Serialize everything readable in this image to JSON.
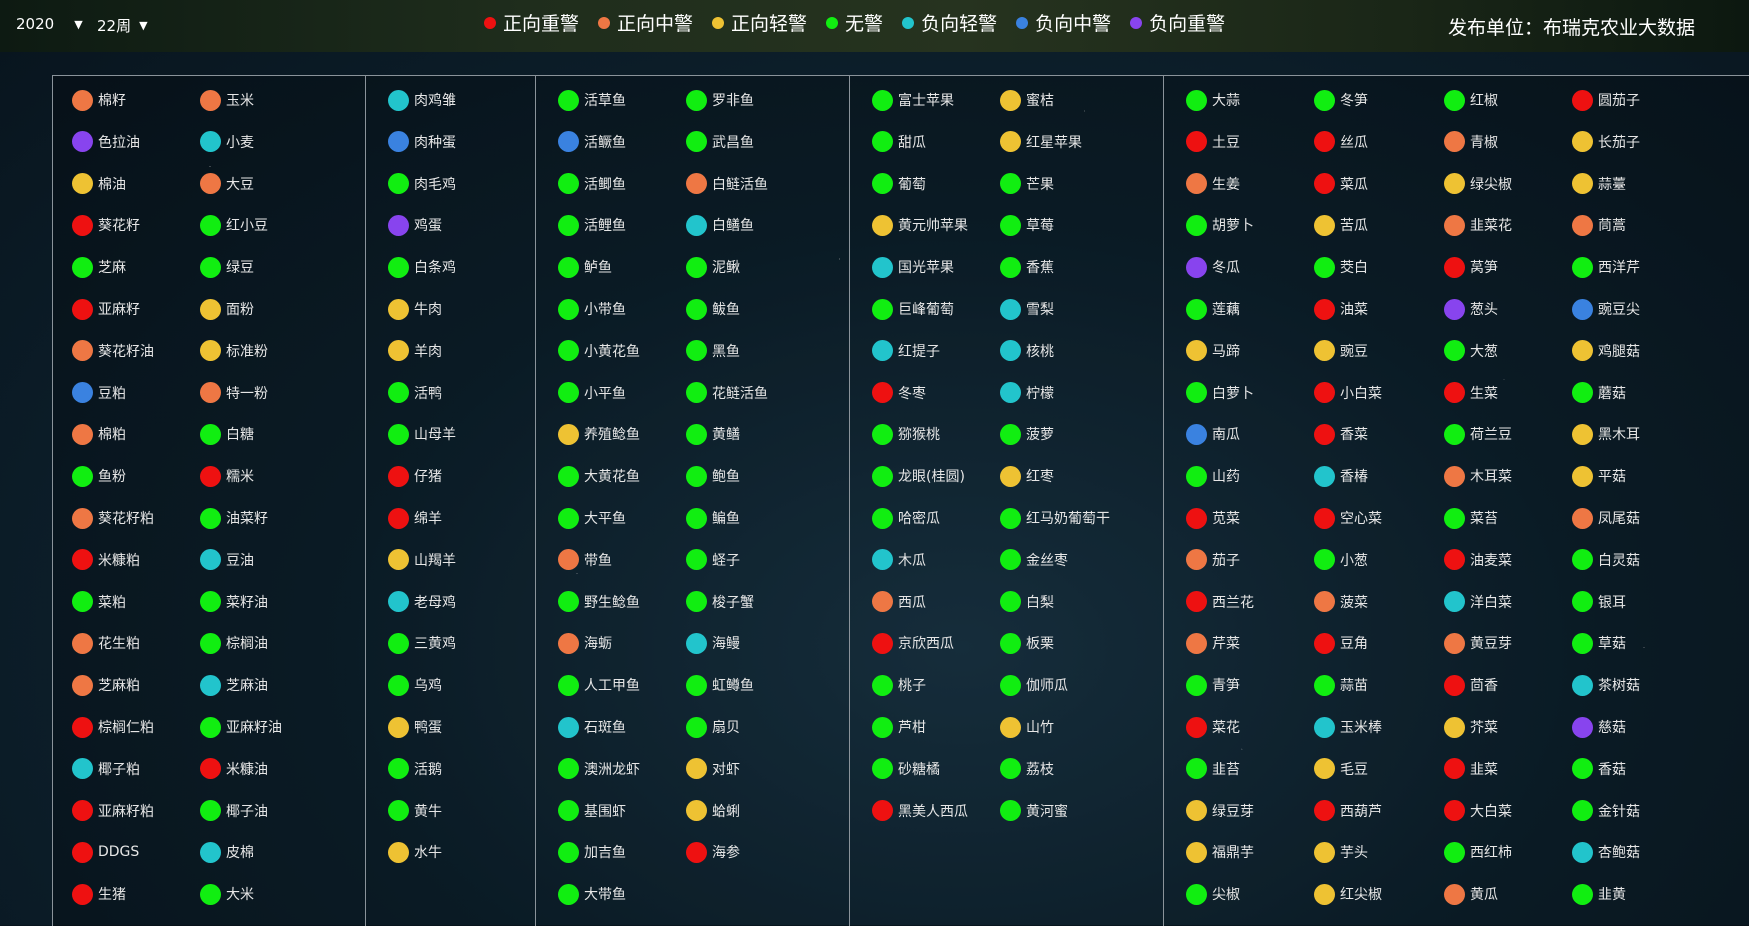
{
  "header": {
    "year": "2020",
    "week": "22周",
    "publisher": "发布单位：布瑞克农业大数据"
  },
  "legend": [
    {
      "key": "pos_severe",
      "label": "正向重警",
      "color": "#ee1111"
    },
    {
      "key": "pos_medium",
      "label": "正向中警",
      "color": "#ee7744"
    },
    {
      "key": "pos_light",
      "label": "正向轻警",
      "color": "#eec233"
    },
    {
      "key": "none",
      "label": "无警",
      "color": "#11ee11"
    },
    {
      "key": "neg_light",
      "label": "负向轻警",
      "color": "#22c4cc"
    },
    {
      "key": "neg_medium",
      "label": "负向中警",
      "color": "#3a82e0"
    },
    {
      "key": "neg_severe",
      "label": "负向重警",
      "color": "#8844ee"
    }
  ],
  "groups": [
    {
      "name": "grains-oils",
      "columns": [
        [
          [
            "棉籽",
            "pos_medium"
          ],
          [
            "色拉油",
            "neg_severe"
          ],
          [
            "棉油",
            "pos_light"
          ],
          [
            "葵花籽",
            "pos_severe"
          ],
          [
            "芝麻",
            "none"
          ],
          [
            "亚麻籽",
            "pos_severe"
          ],
          [
            "葵花籽油",
            "pos_medium"
          ],
          [
            "豆粕",
            "neg_medium"
          ],
          [
            "棉粕",
            "pos_medium"
          ],
          [
            "鱼粉",
            "none"
          ],
          [
            "葵花籽粕",
            "pos_medium"
          ],
          [
            "米糠粕",
            "pos_severe"
          ],
          [
            "菜粕",
            "none"
          ],
          [
            "花生粕",
            "pos_medium"
          ],
          [
            "芝麻粕",
            "pos_medium"
          ],
          [
            "棕榈仁粕",
            "pos_severe"
          ],
          [
            "椰子粕",
            "neg_light"
          ],
          [
            "亚麻籽粕",
            "pos_severe"
          ],
          [
            "DDGS",
            "pos_severe"
          ],
          [
            "生猪",
            "pos_severe"
          ]
        ],
        [
          [
            "玉米",
            "pos_medium"
          ],
          [
            "小麦",
            "neg_light"
          ],
          [
            "大豆",
            "pos_medium"
          ],
          [
            "红小豆",
            "none"
          ],
          [
            "绿豆",
            "none"
          ],
          [
            "面粉",
            "pos_light"
          ],
          [
            "标准粉",
            "pos_light"
          ],
          [
            "特一粉",
            "pos_medium"
          ],
          [
            "白糖",
            "none"
          ],
          [
            "糯米",
            "pos_severe"
          ],
          [
            "油菜籽",
            "none"
          ],
          [
            "豆油",
            "neg_light"
          ],
          [
            "菜籽油",
            "none"
          ],
          [
            "棕榈油",
            "none"
          ],
          [
            "芝麻油",
            "neg_light"
          ],
          [
            "亚麻籽油",
            "none"
          ],
          [
            "米糠油",
            "pos_severe"
          ],
          [
            "椰子油",
            "none"
          ],
          [
            "皮棉",
            "neg_light"
          ],
          [
            "大米",
            "none"
          ]
        ]
      ]
    },
    {
      "name": "livestock",
      "columns": [
        [
          [
            "肉鸡雏",
            "neg_light"
          ],
          [
            "肉种蛋",
            "neg_medium"
          ],
          [
            "肉毛鸡",
            "none"
          ],
          [
            "鸡蛋",
            "neg_severe"
          ],
          [
            "白条鸡",
            "none"
          ],
          [
            "牛肉",
            "pos_light"
          ],
          [
            "羊肉",
            "pos_light"
          ],
          [
            "活鸭",
            "none"
          ],
          [
            "山母羊",
            "none"
          ],
          [
            "仔猪",
            "pos_severe"
          ],
          [
            "绵羊",
            "pos_severe"
          ],
          [
            "山羯羊",
            "pos_light"
          ],
          [
            "老母鸡",
            "neg_light"
          ],
          [
            "三黄鸡",
            "none"
          ],
          [
            "乌鸡",
            "none"
          ],
          [
            "鸭蛋",
            "pos_light"
          ],
          [
            "活鹅",
            "none"
          ],
          [
            "黄牛",
            "none"
          ],
          [
            "水牛",
            "pos_light"
          ]
        ]
      ]
    },
    {
      "name": "aquatic",
      "columns": [
        [
          [
            "活草鱼",
            "none"
          ],
          [
            "活鳜鱼",
            "neg_medium"
          ],
          [
            "活鲫鱼",
            "none"
          ],
          [
            "活鲤鱼",
            "none"
          ],
          [
            "鲈鱼",
            "none"
          ],
          [
            "小带鱼",
            "none"
          ],
          [
            "小黄花鱼",
            "none"
          ],
          [
            "小平鱼",
            "none"
          ],
          [
            "养殖鲶鱼",
            "pos_light"
          ],
          [
            "大黄花鱼",
            "none"
          ],
          [
            "大平鱼",
            "none"
          ],
          [
            "带鱼",
            "pos_medium"
          ],
          [
            "野生鲶鱼",
            "none"
          ],
          [
            "海蛎",
            "pos_medium"
          ],
          [
            "人工甲鱼",
            "none"
          ],
          [
            "石斑鱼",
            "neg_light"
          ],
          [
            "澳洲龙虾",
            "none"
          ],
          [
            "基围虾",
            "none"
          ],
          [
            "加吉鱼",
            "none"
          ],
          [
            "大带鱼",
            "none"
          ]
        ],
        [
          [
            "罗非鱼",
            "none"
          ],
          [
            "武昌鱼",
            "none"
          ],
          [
            "白鲢活鱼",
            "pos_medium"
          ],
          [
            "白鳝鱼",
            "neg_light"
          ],
          [
            "泥鳅",
            "none"
          ],
          [
            "鲅鱼",
            "none"
          ],
          [
            "黑鱼",
            "none"
          ],
          [
            "花鲢活鱼",
            "none"
          ],
          [
            "黄鳝",
            "none"
          ],
          [
            "鲍鱼",
            "none"
          ],
          [
            "鳊鱼",
            "none"
          ],
          [
            "蛏子",
            "none"
          ],
          [
            "梭子蟹",
            "none"
          ],
          [
            "海鳗",
            "neg_light"
          ],
          [
            "虹鳟鱼",
            "none"
          ],
          [
            "扇贝",
            "none"
          ],
          [
            "对虾",
            "pos_light"
          ],
          [
            "蛤蜊",
            "pos_light"
          ],
          [
            "海参",
            "pos_severe"
          ]
        ]
      ]
    },
    {
      "name": "fruits",
      "columns": [
        [
          [
            "富士苹果",
            "none"
          ],
          [
            "甜瓜",
            "none"
          ],
          [
            "葡萄",
            "none"
          ],
          [
            "黄元帅苹果",
            "pos_light"
          ],
          [
            "国光苹果",
            "neg_light"
          ],
          [
            "巨峰葡萄",
            "none"
          ],
          [
            "红提子",
            "neg_light"
          ],
          [
            "冬枣",
            "pos_severe"
          ],
          [
            "猕猴桃",
            "none"
          ],
          [
            "龙眼(桂圆)",
            "none"
          ],
          [
            "哈密瓜",
            "none"
          ],
          [
            "木瓜",
            "neg_light"
          ],
          [
            "西瓜",
            "pos_medium"
          ],
          [
            "京欣西瓜",
            "pos_severe"
          ],
          [
            "桃子",
            "none"
          ],
          [
            "芦柑",
            "none"
          ],
          [
            "砂糖橘",
            "none"
          ],
          [
            "黑美人西瓜",
            "pos_severe"
          ]
        ],
        [
          [
            "蜜桔",
            "pos_light"
          ],
          [
            "红星苹果",
            "pos_light"
          ],
          [
            "芒果",
            "none"
          ],
          [
            "草莓",
            "none"
          ],
          [
            "香蕉",
            "none"
          ],
          [
            "雪梨",
            "neg_light"
          ],
          [
            "核桃",
            "neg_light"
          ],
          [
            "柠檬",
            "neg_light"
          ],
          [
            "菠萝",
            "none"
          ],
          [
            "红枣",
            "pos_light"
          ],
          [
            "红马奶葡萄干",
            "none"
          ],
          [
            "金丝枣",
            "none"
          ],
          [
            "白梨",
            "none"
          ],
          [
            "板栗",
            "none"
          ],
          [
            "伽师瓜",
            "none"
          ],
          [
            "山竹",
            "pos_light"
          ],
          [
            "荔枝",
            "none"
          ],
          [
            "黄河蜜",
            "none"
          ]
        ]
      ]
    },
    {
      "name": "vegetables",
      "columns": [
        [
          [
            "大蒜",
            "none"
          ],
          [
            "土豆",
            "pos_severe"
          ],
          [
            "生姜",
            "pos_medium"
          ],
          [
            "胡萝卜",
            "none"
          ],
          [
            "冬瓜",
            "neg_severe"
          ],
          [
            "莲藕",
            "none"
          ],
          [
            "马蹄",
            "pos_light"
          ],
          [
            "白萝卜",
            "none"
          ],
          [
            "南瓜",
            "neg_medium"
          ],
          [
            "山药",
            "none"
          ],
          [
            "苋菜",
            "pos_severe"
          ],
          [
            "茄子",
            "pos_medium"
          ],
          [
            "西兰花",
            "pos_severe"
          ],
          [
            "芹菜",
            "pos_medium"
          ],
          [
            "青笋",
            "none"
          ],
          [
            "菜花",
            "pos_severe"
          ],
          [
            "韭苔",
            "none"
          ],
          [
            "绿豆芽",
            "pos_light"
          ],
          [
            "福鼎芋",
            "pos_light"
          ],
          [
            "尖椒",
            "none"
          ]
        ],
        [
          [
            "冬笋",
            "none"
          ],
          [
            "丝瓜",
            "pos_severe"
          ],
          [
            "菜瓜",
            "pos_severe"
          ],
          [
            "苦瓜",
            "pos_light"
          ],
          [
            "茭白",
            "none"
          ],
          [
            "油菜",
            "pos_severe"
          ],
          [
            "豌豆",
            "pos_light"
          ],
          [
            "小白菜",
            "pos_severe"
          ],
          [
            "香菜",
            "pos_severe"
          ],
          [
            "香椿",
            "neg_light"
          ],
          [
            "空心菜",
            "pos_severe"
          ],
          [
            "小葱",
            "none"
          ],
          [
            "菠菜",
            "pos_medium"
          ],
          [
            "豆角",
            "pos_severe"
          ],
          [
            "蒜苗",
            "none"
          ],
          [
            "玉米棒",
            "neg_light"
          ],
          [
            "毛豆",
            "pos_light"
          ],
          [
            "西葫芦",
            "pos_severe"
          ],
          [
            "芋头",
            "pos_light"
          ],
          [
            "红尖椒",
            "pos_light"
          ]
        ],
        [
          [
            "红椒",
            "none"
          ],
          [
            "青椒",
            "pos_medium"
          ],
          [
            "绿尖椒",
            "pos_light"
          ],
          [
            "韭菜花",
            "pos_medium"
          ],
          [
            "莴笋",
            "pos_severe"
          ],
          [
            "葱头",
            "neg_severe"
          ],
          [
            "大葱",
            "none"
          ],
          [
            "生菜",
            "pos_severe"
          ],
          [
            "荷兰豆",
            "none"
          ],
          [
            "木耳菜",
            "pos_medium"
          ],
          [
            "菜苔",
            "none"
          ],
          [
            "油麦菜",
            "pos_severe"
          ],
          [
            "洋白菜",
            "neg_light"
          ],
          [
            "黄豆芽",
            "pos_medium"
          ],
          [
            "茴香",
            "pos_severe"
          ],
          [
            "芥菜",
            "pos_light"
          ],
          [
            "韭菜",
            "pos_severe"
          ],
          [
            "大白菜",
            "pos_severe"
          ],
          [
            "西红柿",
            "none"
          ],
          [
            "黄瓜",
            "pos_medium"
          ]
        ],
        [
          [
            "圆茄子",
            "pos_severe"
          ],
          [
            "长茄子",
            "pos_light"
          ],
          [
            "蒜薹",
            "pos_light"
          ],
          [
            "茼蒿",
            "pos_medium"
          ],
          [
            "西洋芹",
            "none"
          ],
          [
            "豌豆尖",
            "neg_medium"
          ],
          [
            "鸡腿菇",
            "pos_light"
          ],
          [
            "蘑菇",
            "none"
          ],
          [
            "黑木耳",
            "pos_light"
          ],
          [
            "平菇",
            "pos_light"
          ],
          [
            "凤尾菇",
            "pos_medium"
          ],
          [
            "白灵菇",
            "none"
          ],
          [
            "银耳",
            "none"
          ],
          [
            "草菇",
            "none"
          ],
          [
            "茶树菇",
            "neg_light"
          ],
          [
            "慈菇",
            "neg_severe"
          ],
          [
            "香菇",
            "none"
          ],
          [
            "金针菇",
            "none"
          ],
          [
            "杏鲍菇",
            "neg_light"
          ],
          [
            "韭黄",
            "none"
          ]
        ]
      ]
    }
  ]
}
